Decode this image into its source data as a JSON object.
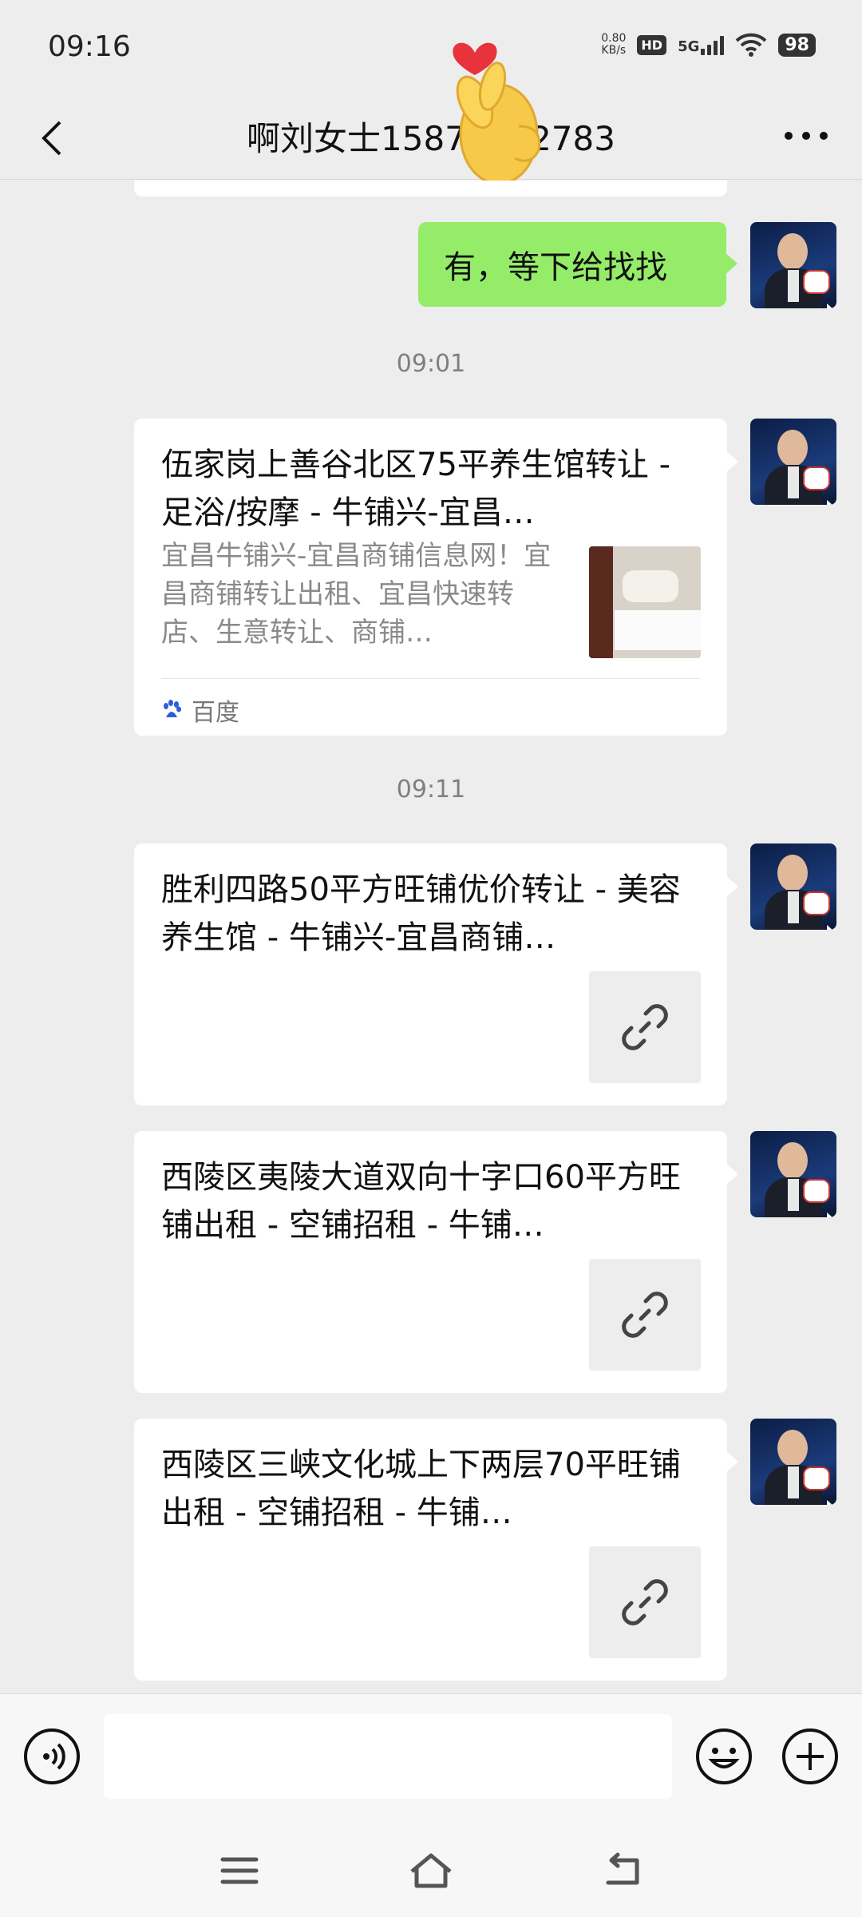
{
  "status_bar": {
    "time": "09:16",
    "net_speed_value": "0.80",
    "net_speed_unit": "KB/s",
    "hd_badge": "HD",
    "network": "5G",
    "battery": "98"
  },
  "header": {
    "title": "啊刘女士15871942783",
    "back_icon": "chevron-left-icon",
    "more_icon": "ellipsis-icon"
  },
  "messages": [
    {
      "type": "text",
      "from": "me",
      "text": "有，等下给找找"
    },
    {
      "type": "time",
      "text": "09:01"
    },
    {
      "type": "link_card",
      "from": "me",
      "title": "伍家岗上善谷北区75平养生馆转让 - 足浴/按摩 - 牛铺兴-宜昌…",
      "description": "宜昌牛铺兴-宜昌商铺信息网！宜昌商铺转让出租、宜昌快速转店、生意转让、商铺…",
      "source": "百度"
    },
    {
      "type": "time",
      "text": "09:11"
    },
    {
      "type": "link_card",
      "from": "me",
      "title": "胜利四路50平方旺铺优价转让 - 美容养生馆 - 牛铺兴-宜昌商铺…"
    },
    {
      "type": "link_card",
      "from": "me",
      "title": "西陵区夷陵大道双向十字口60平方旺铺出租 - 空铺招租 - 牛铺…"
    },
    {
      "type": "link_card",
      "from": "me",
      "title": "西陵区三峡文化城上下两层70平旺铺出租 - 空铺招租 - 牛铺…"
    }
  ],
  "input_bar": {
    "voice_icon": "voice-icon",
    "input_value": "",
    "emoji_icon": "emoji-icon",
    "plus_icon": "plus-icon"
  },
  "system_nav": {
    "menu_icon": "menu-icon",
    "home_icon": "home-icon",
    "back_icon": "back-arrow-icon"
  },
  "colors": {
    "background": "#ededed",
    "my_bubble": "#95ec69",
    "card": "#ffffff",
    "time_label": "#7f7f7f"
  }
}
